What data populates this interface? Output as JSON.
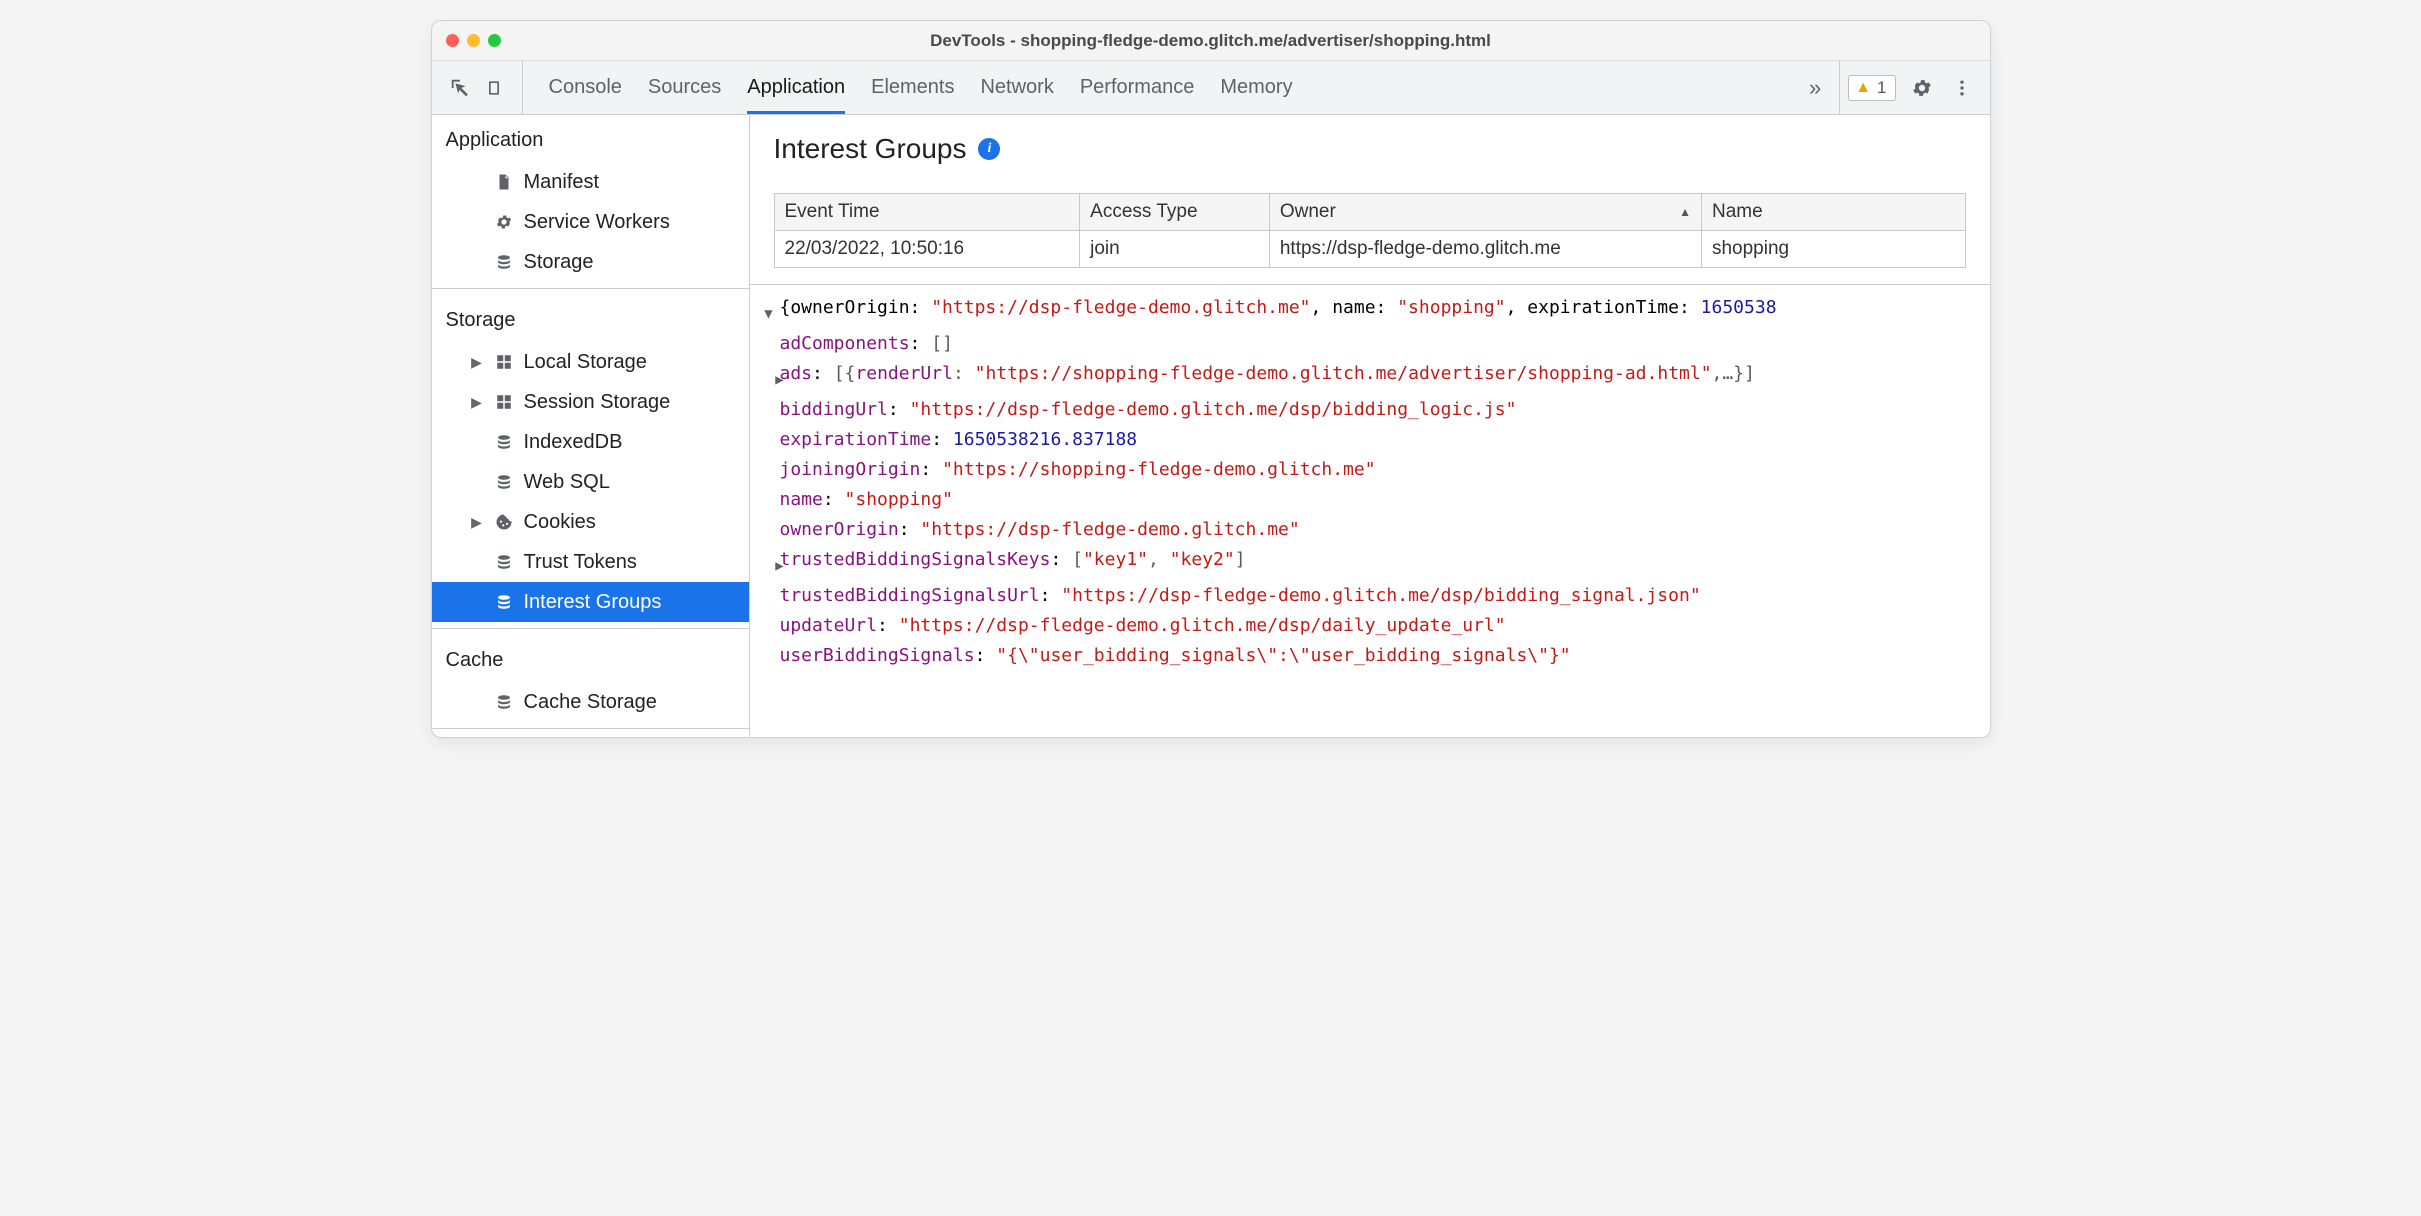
{
  "window": {
    "title": "DevTools - shopping-fledge-demo.glitch.me/advertiser/shopping.html"
  },
  "toolbar": {
    "tabs": [
      "Console",
      "Sources",
      "Application",
      "Elements",
      "Network",
      "Performance",
      "Memory"
    ],
    "active_tab_index": 2,
    "warning_count": "1"
  },
  "sidebar": {
    "sections": [
      {
        "heading": "Application",
        "items": [
          {
            "label": "Manifest",
            "icon": "file-icon",
            "caret": false
          },
          {
            "label": "Service Workers",
            "icon": "gear-icon",
            "caret": false
          },
          {
            "label": "Storage",
            "icon": "db-icon",
            "caret": false
          }
        ]
      },
      {
        "heading": "Storage",
        "items": [
          {
            "label": "Local Storage",
            "icon": "grid-icon",
            "caret": true
          },
          {
            "label": "Session Storage",
            "icon": "grid-icon",
            "caret": true
          },
          {
            "label": "IndexedDB",
            "icon": "db-icon",
            "caret": false
          },
          {
            "label": "Web SQL",
            "icon": "db-icon",
            "caret": false
          },
          {
            "label": "Cookies",
            "icon": "cookie-icon",
            "caret": true
          },
          {
            "label": "Trust Tokens",
            "icon": "db-icon",
            "caret": false
          },
          {
            "label": "Interest Groups",
            "icon": "db-icon",
            "caret": false,
            "selected": true
          }
        ]
      },
      {
        "heading": "Cache",
        "items": [
          {
            "label": "Cache Storage",
            "icon": "db-icon",
            "caret": false
          }
        ]
      }
    ]
  },
  "main": {
    "title": "Interest Groups",
    "table": {
      "columns": [
        "Event Time",
        "Access Type",
        "Owner",
        "Name"
      ],
      "col_widths": [
        "290",
        "180",
        "410",
        "250"
      ],
      "sort_col_index": 2,
      "rows": [
        [
          "22/03/2022, 10:50:16",
          "join",
          "https://dsp-fledge-demo.glitch.me",
          "shopping"
        ]
      ]
    },
    "object": {
      "summary_prefix": "{ownerOrigin: ",
      "summary_owner": "\"https://dsp-fledge-demo.glitch.me\"",
      "summary_mid": ", name: ",
      "summary_name": "\"shopping\"",
      "summary_tail_key": ", expirationTime: ",
      "summary_tail_val": "1650538",
      "lines": [
        {
          "key": "adComponents",
          "raw": "[]",
          "kind": "gray",
          "caret": ""
        },
        {
          "key": "ads",
          "raw": "[{renderUrl: \"https://shopping-fledge-demo.glitch.me/advertiser/shopping-ad.html\",…}]",
          "kind": "gray",
          "caret": "▶"
        },
        {
          "key": "biddingUrl",
          "raw": "\"https://dsp-fledge-demo.glitch.me/dsp/bidding_logic.js\"",
          "kind": "string",
          "caret": ""
        },
        {
          "key": "expirationTime",
          "raw": "1650538216.837188",
          "kind": "number",
          "caret": ""
        },
        {
          "key": "joiningOrigin",
          "raw": "\"https://shopping-fledge-demo.glitch.me\"",
          "kind": "string",
          "caret": ""
        },
        {
          "key": "name",
          "raw": "\"shopping\"",
          "kind": "string",
          "caret": ""
        },
        {
          "key": "ownerOrigin",
          "raw": "\"https://dsp-fledge-demo.glitch.me\"",
          "kind": "string",
          "caret": ""
        },
        {
          "key": "trustedBiddingSignalsKeys",
          "raw": "[\"key1\", \"key2\"]",
          "kind": "gray",
          "caret": "▶"
        },
        {
          "key": "trustedBiddingSignalsUrl",
          "raw": "\"https://dsp-fledge-demo.glitch.me/dsp/bidding_signal.json\"",
          "kind": "string",
          "caret": ""
        },
        {
          "key": "updateUrl",
          "raw": "\"https://dsp-fledge-demo.glitch.me/dsp/daily_update_url\"",
          "kind": "string",
          "caret": ""
        },
        {
          "key": "userBiddingSignals",
          "raw": "\"{\\\"user_bidding_signals\\\":\\\"user_bidding_signals\\\"}\"",
          "kind": "string",
          "caret": ""
        }
      ]
    }
  }
}
